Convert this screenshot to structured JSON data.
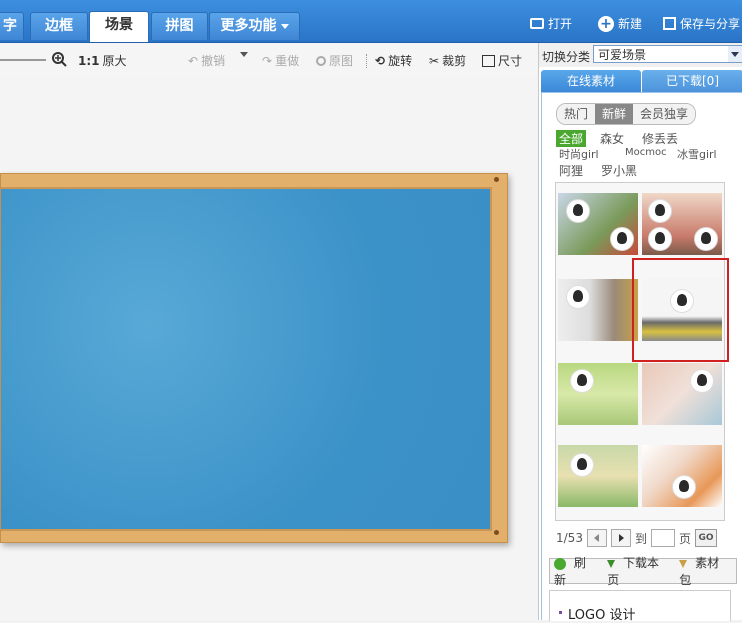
{
  "tabs": [
    {
      "label": "字"
    },
    {
      "label": "边框"
    },
    {
      "label": "场景"
    },
    {
      "label": "拼图"
    },
    {
      "label": "更多功能"
    }
  ],
  "top_actions": {
    "open": "打开",
    "new": "新建",
    "save_share": "保存与分享"
  },
  "toolbar": {
    "zoom_ratio": "1:1",
    "original_size": "原大",
    "undo": "撤销",
    "redo": "重做",
    "original": "原图",
    "rotate": "旋转",
    "crop": "裁剪",
    "size": "尺寸"
  },
  "panel": {
    "switch_label": "切换分类",
    "switch_value": "可爱场景",
    "tab_online": "在线素材",
    "tab_downloaded": "已下载[0]",
    "filters": [
      "热门",
      "新鲜",
      "会员独享"
    ],
    "selected_filter": "新鲜",
    "categories_row1": [
      "全部",
      "森女",
      "修丢丢"
    ],
    "categories_row2": [
      "时尚girl",
      "Mocmoc",
      "冰雪girl"
    ],
    "categories_row3": [
      "阿狸",
      "罗小黑"
    ],
    "pager_text": "1/53",
    "goto_label": "到",
    "page_label": "页",
    "go_button": "GO",
    "actions": [
      "刷新",
      "下载本页",
      "素材包"
    ],
    "logo_link": "LOGO 设计"
  },
  "colors": {
    "accent": "#2a74c6",
    "highlight": "#d02020",
    "board_frame": "#e2b06a",
    "board_surface": "#3b92c8"
  }
}
